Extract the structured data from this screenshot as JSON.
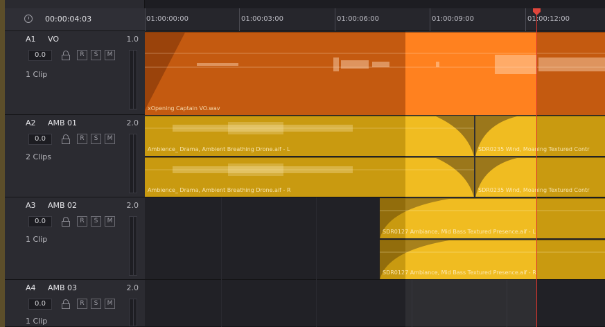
{
  "header": {
    "timecode": "00:00:04:03"
  },
  "ruler": {
    "labels": [
      "01:00:00:00",
      "01:00:03:00",
      "01:00:06:00",
      "01:00:09:00",
      "01:00:12:00"
    ]
  },
  "tracks": [
    {
      "id": "A1",
      "name": "VO",
      "level": "1.0",
      "volume": "0.0",
      "btn_r": "R",
      "btn_s": "S",
      "btn_m": "M",
      "clip_count": "1 Clip"
    },
    {
      "id": "A2",
      "name": "AMB 01",
      "level": "2.0",
      "volume": "0.0",
      "btn_r": "R",
      "btn_s": "S",
      "btn_m": "M",
      "clip_count": "2 Clips"
    },
    {
      "id": "A3",
      "name": "AMB 02",
      "level": "2.0",
      "volume": "0.0",
      "btn_r": "R",
      "btn_s": "S",
      "btn_m": "M",
      "clip_count": "1 Clip"
    },
    {
      "id": "A4",
      "name": "AMB 03",
      "level": "2.0",
      "volume": "0.0",
      "btn_r": "R",
      "btn_s": "S",
      "btn_m": "M",
      "clip_count": "1 Clip"
    }
  ],
  "clips": {
    "vo": "xOpening Captain VO.wav",
    "amb01_l": "Ambience_ Drama, Ambient Breathing Drone.aif - L",
    "amb01_r": "Ambience_ Drama, Ambient Breathing Drone.aif - R",
    "wind_l": "SDR0235 Wind, Moaning Textured Contr",
    "wind_r": "SDR0235 Wind, Moaning Textured Contr",
    "amb02_l": "SDR0127 Ambiance, Mid Bass Textured Presence.aif - L",
    "amb02_r": "SDR0127 Ambiance, Mid Bass Textured Presence.aif - R"
  },
  "colors": {
    "vo_clip": "#c45a10",
    "vo_selected": "#ff7a12",
    "amb_clip": "#c99a10",
    "amb_selected": "#f0b814",
    "playhead": "#d8342c",
    "inout_range": "#4b8b3a"
  }
}
